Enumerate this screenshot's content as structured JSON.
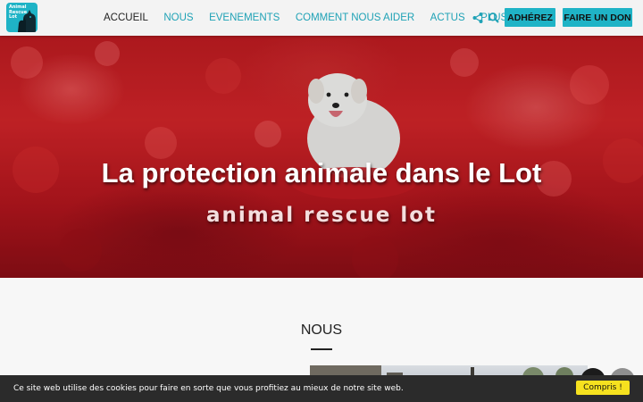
{
  "header": {
    "logo": {
      "lines": [
        "Animal",
        "Rescue",
        "Lot"
      ],
      "icon": "dog-cat-logo-icon",
      "color": "#1fb3c6"
    },
    "nav": [
      {
        "label": "ACCUEIL",
        "active": true
      },
      {
        "label": "NOUS",
        "active": false
      },
      {
        "label": "EVENEMENTS",
        "active": false
      },
      {
        "label": "COMMENT NOUS AIDER",
        "active": false
      },
      {
        "label": "ACTUS",
        "active": false
      },
      {
        "label": "PLUS",
        "active": false,
        "dropdown": true
      }
    ],
    "icons": [
      "share-icon",
      "search-icon"
    ],
    "buttons": {
      "join": "ADHÉREZ",
      "donate": "FAIRE UN DON"
    },
    "accent_color": "#1fb3c6"
  },
  "hero": {
    "title": "La protection animale dans le Lot",
    "subtitle": "animal rescue lot",
    "image": "white-dog-in-red-flower-field"
  },
  "section": {
    "title": "NOUS"
  },
  "cookie": {
    "text": "Ce site web utilise des cookies pour faire en sorte que vous profitiez au mieux de notre site web.",
    "button": "Compris !",
    "button_color": "#f6e11f"
  }
}
